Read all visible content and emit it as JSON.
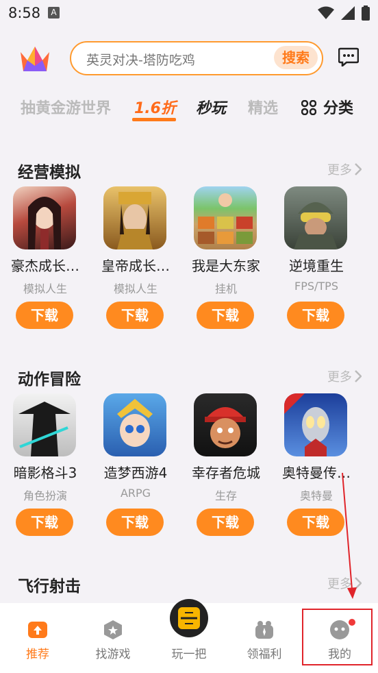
{
  "status": {
    "time": "8:58",
    "notif_letter": "A"
  },
  "search": {
    "placeholder": "英灵对决-塔防吃鸡",
    "button": "搜索"
  },
  "tabs": [
    {
      "label": "抽黄金游世界"
    },
    {
      "label": "1.6折"
    },
    {
      "label": "秒玩"
    },
    {
      "label": "精选"
    },
    {
      "label": "分类"
    }
  ],
  "sections": [
    {
      "title": "经营模拟",
      "more": "更多",
      "games": [
        {
          "name": "豪杰成长…",
          "tag": "模拟人生",
          "button": "下载",
          "icon_color": "#7a2b2b"
        },
        {
          "name": "皇帝成长…",
          "tag": "模拟人生",
          "button": "下载",
          "icon_color": "#c79a3c"
        },
        {
          "name": "我是大东家",
          "tag": "挂机",
          "button": "下载",
          "icon_color": "#b98a4a"
        },
        {
          "name": "逆境重生",
          "tag": "FPS/TPS",
          "button": "下载",
          "icon_color": "#4a5a4a"
        }
      ]
    },
    {
      "title": "动作冒险",
      "more": "更多",
      "games": [
        {
          "name": "暗影格斗3",
          "tag": "角色扮演",
          "button": "下载",
          "icon_color": "#e8e8e8"
        },
        {
          "name": "造梦西游4",
          "tag": "ARPG",
          "button": "下载",
          "icon_color": "#3a7fd0"
        },
        {
          "name": "幸存者危城",
          "tag": "生存",
          "button": "下载",
          "icon_color": "#c0392b"
        },
        {
          "name": "奥特曼传…",
          "tag": "奥特曼",
          "button": "下载",
          "icon_color": "#2a4fae"
        }
      ]
    },
    {
      "title": "飞行射击",
      "more": "更多"
    }
  ],
  "nav": [
    {
      "label": "推荐"
    },
    {
      "label": "找游戏"
    },
    {
      "label": "玩一把",
      "center_text": "玩一把"
    },
    {
      "label": "领福利"
    },
    {
      "label": "我的"
    }
  ],
  "colors": {
    "accent": "#ff7a1a",
    "highlight": "#e0242a"
  }
}
